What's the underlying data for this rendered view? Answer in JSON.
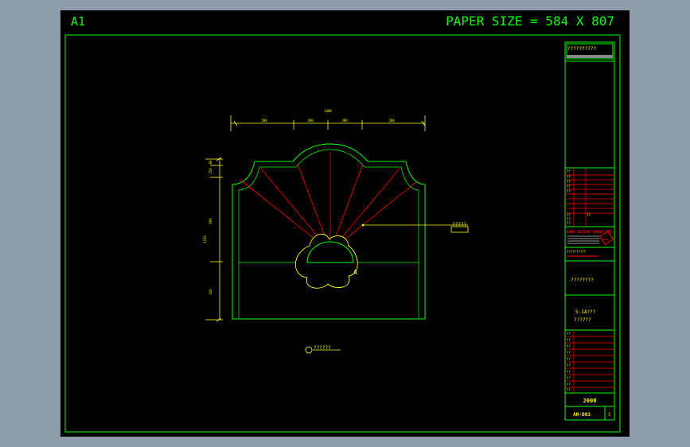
{
  "sheet": {
    "size_label": "A1",
    "paper_size": "PAPER SIZE = 584 X 807"
  },
  "drawing": {
    "width_dimension": "1400",
    "segment_dimensions": [
      "200",
      "300",
      "300",
      "200"
    ],
    "height_dimension": "1150",
    "side_dimensions": [
      "80",
      "150",
      "600",
      "320"
    ],
    "leader_note": "?????",
    "scale_note": "??????",
    "marker_label": "A"
  },
  "title_block": {
    "header_text": "??????????",
    "table_a_rows": [
      "??",
      "??",
      "??",
      "??",
      "??",
      "??",
      "??",
      "??",
      "??"
    ],
    "company_line": "XXXX DESIGN GROUP LTD",
    "project_line": "??????????",
    "stamp_label": "2008",
    "drawing_name": "????????",
    "drawing_title_1": "5-1A???",
    "drawing_title_2": "??????",
    "table_b_rows": [
      "??",
      "??",
      "??",
      "??",
      "??",
      "??",
      "??",
      "??",
      "??",
      "??"
    ],
    "year": "2008",
    "drawing_number": "AR-D03",
    "revision": "C"
  },
  "colors": {
    "frame": "#00ff00",
    "outline": "#00ff00",
    "dimension": "#ffff00",
    "fan_lines": "#ff0000",
    "note": "#ffff00"
  }
}
